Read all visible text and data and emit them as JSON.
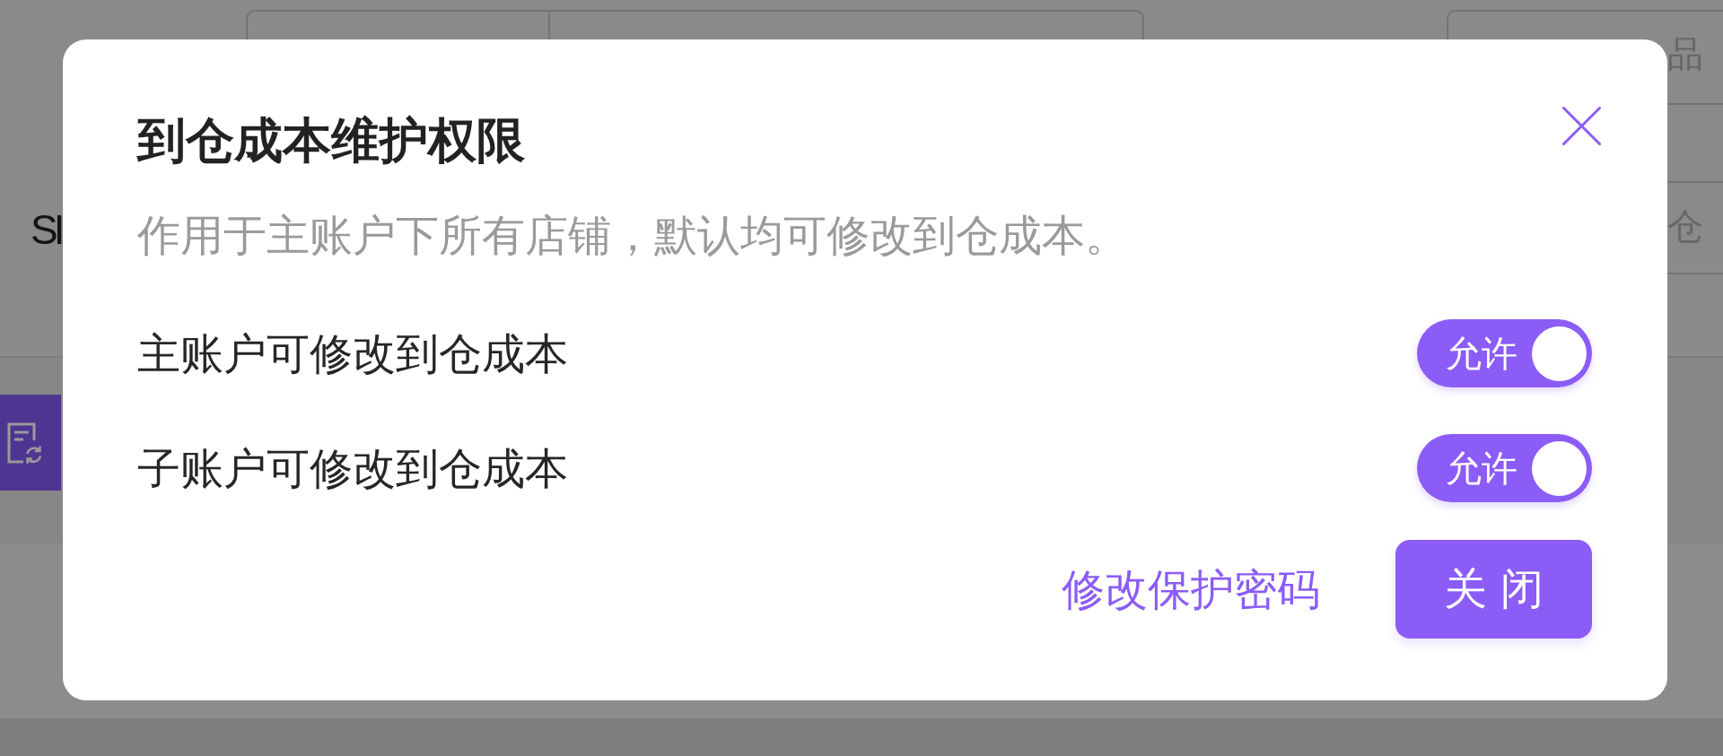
{
  "background_page": {
    "label": "SI",
    "fields": [
      {
        "placeholder": "品"
      },
      {
        "placeholder": "仓"
      }
    ]
  },
  "dialog": {
    "title": "到仓成本维护权限",
    "description": "作用于主账户下所有店铺，默认均可修改到仓成本。",
    "settings": [
      {
        "label": "主账户可修改到仓成本",
        "on": true,
        "switch_text": "允许"
      },
      {
        "label": "子账户可修改到仓成本",
        "on": true,
        "switch_text": "允许"
      }
    ],
    "link": "修改保护密码",
    "buttons": [
      {
        "label": "关 闭",
        "kind": "primary"
      }
    ]
  }
}
